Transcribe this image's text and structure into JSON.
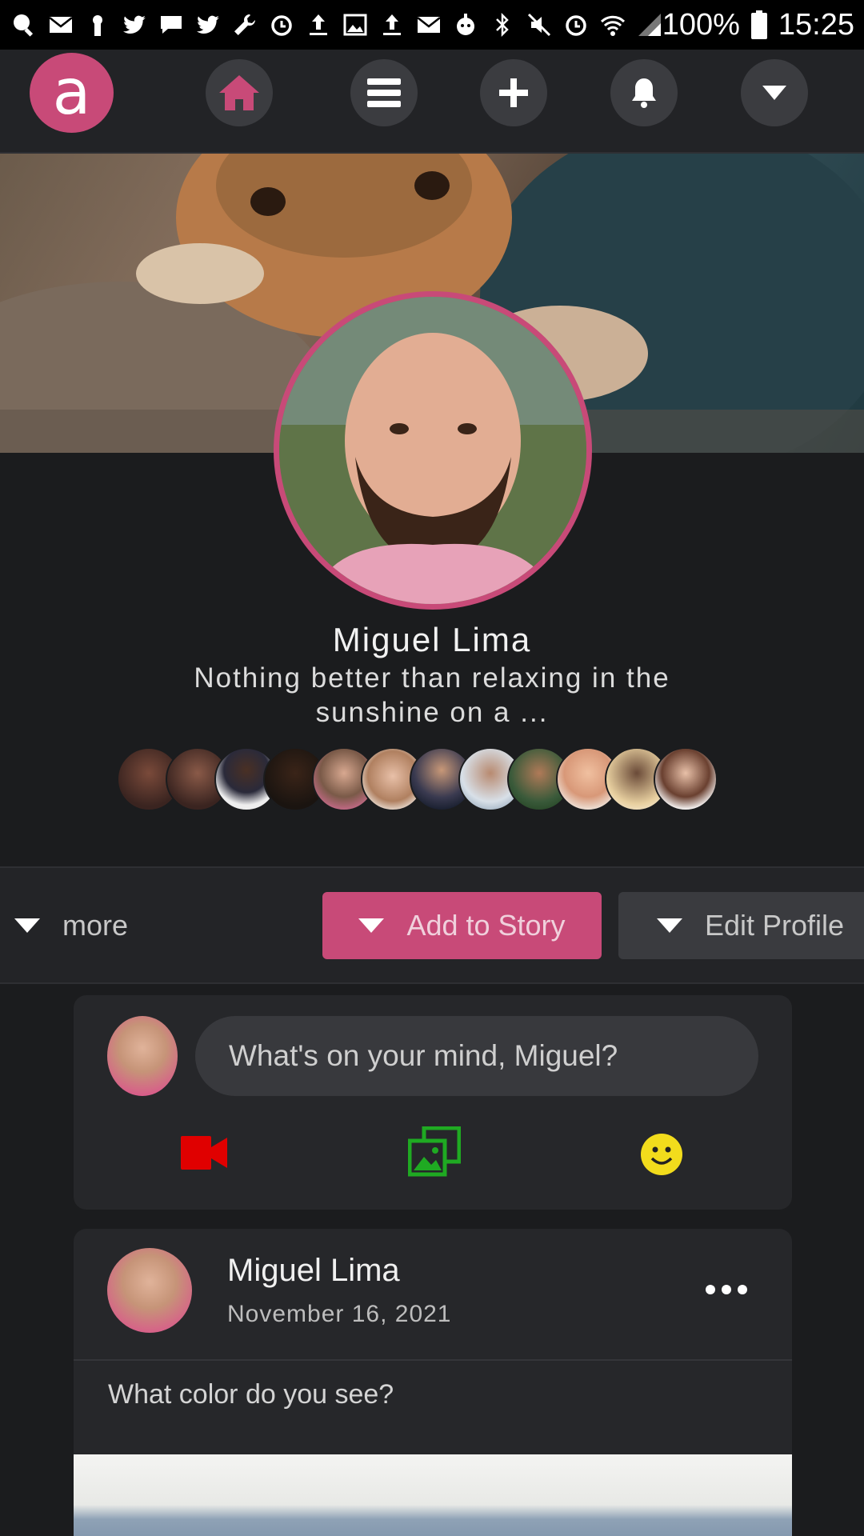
{
  "statusbar": {
    "battery": "100%",
    "time": "15:25",
    "icons": [
      "search-icon",
      "mail-icon",
      "keyhole-icon",
      "twitter-icon",
      "chat-icon",
      "twitter-icon",
      "wrench-icon",
      "alarm-icon",
      "upload-icon",
      "image-icon",
      "upload-icon",
      "mail-icon",
      "bot-icon",
      "bluetooth-icon",
      "mute-icon",
      "alarm-icon",
      "wifi-icon",
      "signal-icon",
      "battery-icon"
    ]
  },
  "nav": {
    "logo": "a",
    "icons": [
      "home-icon",
      "menu-icon",
      "plus-icon",
      "bell-icon",
      "dropdown-icon"
    ],
    "accent": "#c84a78"
  },
  "profile": {
    "name": "Miguel Lima",
    "bio": "Nothing better than relaxing in the sunshine on a ..."
  },
  "actions": {
    "more": "more",
    "add_story": "Add to Story",
    "edit_profile": "Edit Profile"
  },
  "composer": {
    "placeholder": "What's on your mind, Miguel?",
    "icons": [
      "video-icon",
      "photo-icon",
      "emoji-icon"
    ],
    "colors": {
      "video": "#e00000",
      "photo": "#1faa22",
      "emoji": "#f2dc1c"
    }
  },
  "post": {
    "author": "Miguel Lima",
    "date": "November 16, 2021",
    "text": "What color do you see?"
  }
}
